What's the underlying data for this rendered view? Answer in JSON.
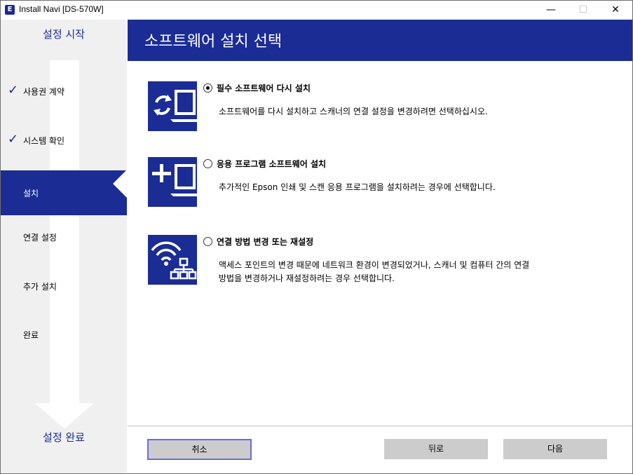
{
  "titlebar": {
    "app_icon": "E",
    "title": "Install Navi [DS-570W]",
    "minimize": "—",
    "maximize": "☐",
    "close": "✕"
  },
  "sidebar": {
    "start_label": "설정 시작",
    "end_label": "설정 완료",
    "steps": [
      {
        "label": "사용권 계약",
        "state": "done",
        "check": "✓"
      },
      {
        "label": "시스템 확인",
        "state": "done",
        "check": "✓"
      },
      {
        "label": "설치",
        "state": "active"
      },
      {
        "label": "연결 설정",
        "state": "pending"
      },
      {
        "label": "추가 설치",
        "state": "pending"
      },
      {
        "label": "완료",
        "state": "pending"
      }
    ]
  },
  "header": {
    "title": "소프트웨어 설치 선택"
  },
  "options": [
    {
      "title": "필수 소프트웨어 다시 설치",
      "description": [
        "소프트웨어를 다시 설치하고 스캐너의 연결 설정을 변경하려면 선택하십시오."
      ],
      "selected": true,
      "icon": "reinstall-icon"
    },
    {
      "title": "응용 프로그램 소프트웨어 설치",
      "description": [
        "추가적인 Epson 인쇄 및 스캔 응용 프로그램을 설치하려는 경우에 선택합니다."
      ],
      "selected": false,
      "icon": "add-application-icon"
    },
    {
      "title": "연결 방법 변경 또는 재설정",
      "description": [
        "액세스 포인트의 변경 때문에 네트워크 환경이 변경되었거나, 스캐너 및 컴퓨터 간의 연결",
        "방법을 변경하거나 재설정하려는 경우 선택합니다."
      ],
      "selected": false,
      "icon": "network-connection-icon"
    }
  ],
  "footer": {
    "cancel_label": "취소",
    "back_label": "뒤로",
    "next_label": "다음"
  },
  "colors": {
    "brand_blue": "#1b2c95",
    "sidebar_bg": "#f0f0f0",
    "button_bg": "#cccccc",
    "focus_border": "#6a6ae6"
  }
}
